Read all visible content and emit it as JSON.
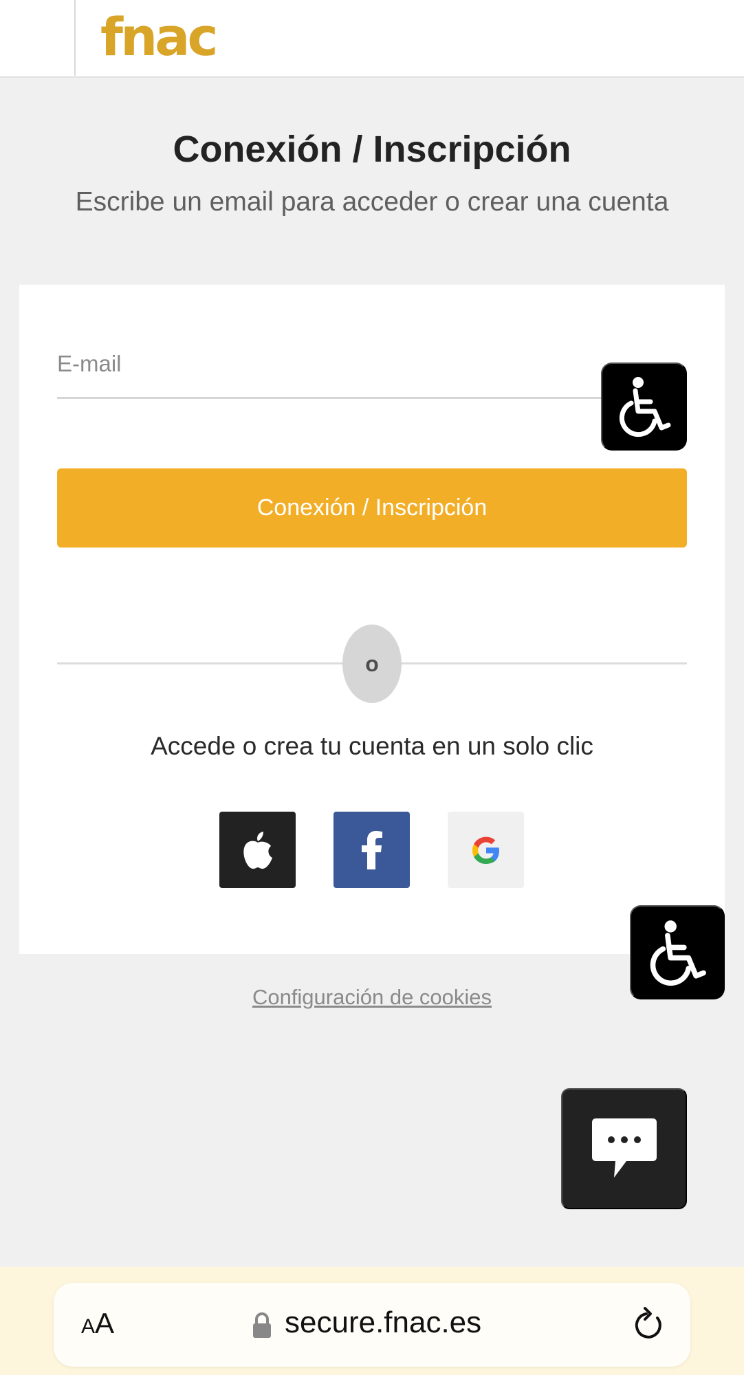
{
  "header": {
    "logo_text": "fnac"
  },
  "login": {
    "title": "Conexión / Inscripción",
    "subtitle": "Escribe un email para acceder o crear una cuenta",
    "email_placeholder": "E-mail",
    "submit_label": "Conexión / Inscripción",
    "separator_label": "o",
    "social_text": "Accede o crea tu cuenta en un solo clic",
    "social_buttons": [
      "apple-icon",
      "facebook-icon",
      "google-icon"
    ]
  },
  "footer": {
    "cookies_link": "Configuración de cookies"
  },
  "floating": {
    "accessibility_icon": "wheelchair-icon",
    "chat_icon": "chat-bubble-icon"
  },
  "browser": {
    "text_size_label": "AA",
    "text_size_small": "A",
    "text_size_large": "A",
    "url": "secure.fnac.es"
  },
  "colors": {
    "brand": "#d9a528",
    "primary_button": "#f2ae27",
    "facebook": "#3b5999",
    "apple": "#222222",
    "background": "#f0f0f0"
  }
}
